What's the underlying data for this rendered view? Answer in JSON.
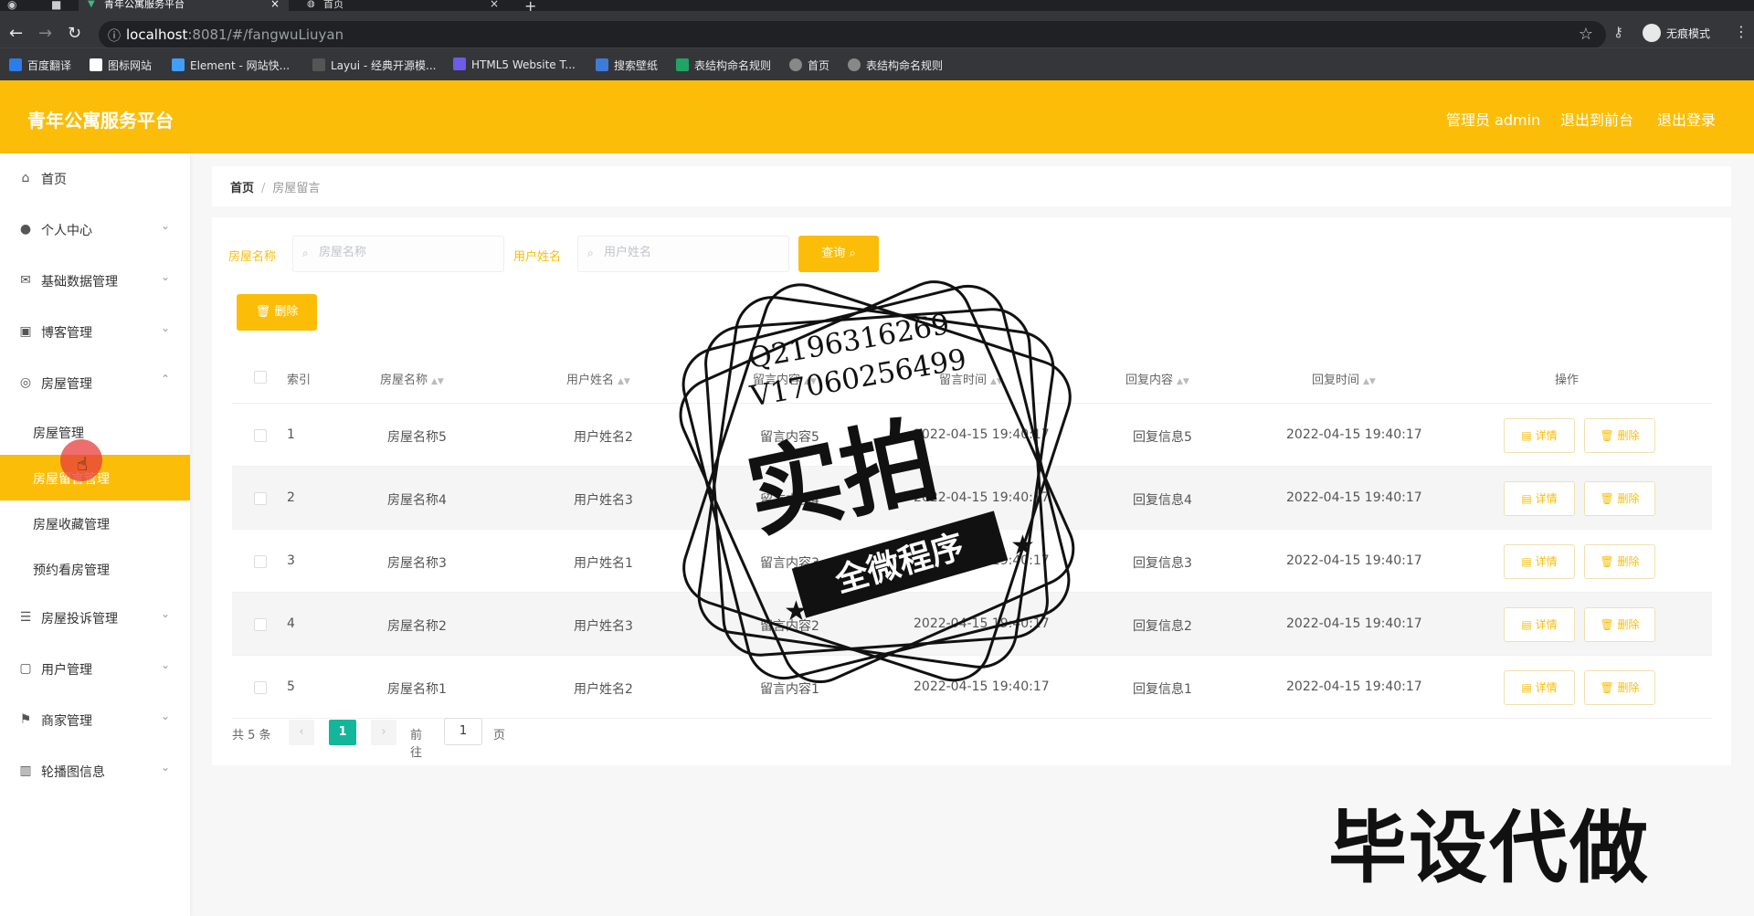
{
  "browser": {
    "tabs": [
      {
        "title": "青年公寓服务平台"
      },
      {
        "title": "首页"
      }
    ],
    "url_host": "localhost",
    "url_rest": ":8081/#/fangwuLiuyan",
    "incognito_label": "无痕模式",
    "bookmarks": [
      {
        "label": "百度翻译",
        "color": "#2b7de9"
      },
      {
        "label": "图标网站",
        "color": "#ffffff"
      },
      {
        "label": "Element - 网站快...",
        "color": "#409eff"
      },
      {
        "label": "Layui - 经典开源模...",
        "color": "#dddddd"
      },
      {
        "label": "HTML5 Website T...",
        "color": "#6c5ce7"
      },
      {
        "label": "搜索壁纸",
        "color": "#3d7bd9"
      },
      {
        "label": "表结构命名规则",
        "color": "#21a366"
      },
      {
        "label": "首页",
        "color": "#dddddd"
      },
      {
        "label": "表结构命名规则",
        "color": "#dddddd"
      }
    ]
  },
  "header": {
    "title": "青年公寓服务平台",
    "user": "管理员 admin",
    "front_link": "退出到前台",
    "logout": "退出登录"
  },
  "sidebar": {
    "items": [
      {
        "label": "首页",
        "icon": "⌂"
      },
      {
        "label": "个人中心",
        "icon": "●"
      },
      {
        "label": "基础数据管理",
        "icon": "✉"
      },
      {
        "label": "博客管理",
        "icon": "▣"
      },
      {
        "label": "房屋管理",
        "icon": "◎"
      }
    ],
    "sub_items": [
      {
        "label": "房屋管理"
      },
      {
        "label": "房屋留言管理"
      },
      {
        "label": "房屋收藏管理"
      },
      {
        "label": "预约看房管理"
      }
    ],
    "items_after": [
      {
        "label": "房屋投诉管理",
        "icon": "☰"
      },
      {
        "label": "用户管理",
        "icon": "▢"
      },
      {
        "label": "商家管理",
        "icon": "⚑"
      },
      {
        "label": "轮播图信息",
        "icon": "▥"
      }
    ]
  },
  "breadcrumb": {
    "home": "首页",
    "current": "房屋留言"
  },
  "filters": {
    "house_label": "房屋名称",
    "house_placeholder": "房屋名称",
    "user_label": "用户姓名",
    "user_placeholder": "用户姓名",
    "search_btn": "查询",
    "delete_btn": "删除"
  },
  "table": {
    "columns": [
      "索引",
      "房屋名称",
      "用户姓名",
      "留言内容",
      "留言时间",
      "回复内容",
      "回复时间",
      "操作"
    ],
    "rows": [
      {
        "idx": "1",
        "house": "房屋名称5",
        "user": "用户姓名2",
        "msg": "留言内容5",
        "msg_time": "2022-04-15 19:40:17",
        "reply": "回复信息5",
        "reply_time": "2022-04-15 19:40:17"
      },
      {
        "idx": "2",
        "house": "房屋名称4",
        "user": "用户姓名3",
        "msg": "留言内容4",
        "msg_time": "2022-04-15 19:40:17",
        "reply": "回复信息4",
        "reply_time": "2022-04-15 19:40:17"
      },
      {
        "idx": "3",
        "house": "房屋名称3",
        "user": "用户姓名1",
        "msg": "留言内容3",
        "msg_time": "2022-04-15 19:40:17",
        "reply": "回复信息3",
        "reply_time": "2022-04-15 19:40:17"
      },
      {
        "idx": "4",
        "house": "房屋名称2",
        "user": "用户姓名3",
        "msg": "留言内容2",
        "msg_time": "2022-04-15 19:40:17",
        "reply": "回复信息2",
        "reply_time": "2022-04-15 19:40:17"
      },
      {
        "idx": "5",
        "house": "房屋名称1",
        "user": "用户姓名2",
        "msg": "留言内容1",
        "msg_time": "2022-04-15 19:40:17",
        "reply": "回复信息1",
        "reply_time": "2022-04-15 19:40:17"
      }
    ],
    "detail_btn": "详情",
    "delete_btn": "删除"
  },
  "pagination": {
    "total": "共 5 条",
    "current_page": "1",
    "goto": "前往",
    "goto_value": "1",
    "unit": "页"
  },
  "watermark": {
    "line1": "Q2196316269",
    "line2": "V17060256499",
    "big": "实拍",
    "ribbon": "全微程序"
  },
  "overlay_text": "毕设代做",
  "colors": {
    "accent": "#fbbd08",
    "page_active": "#13b69a"
  }
}
